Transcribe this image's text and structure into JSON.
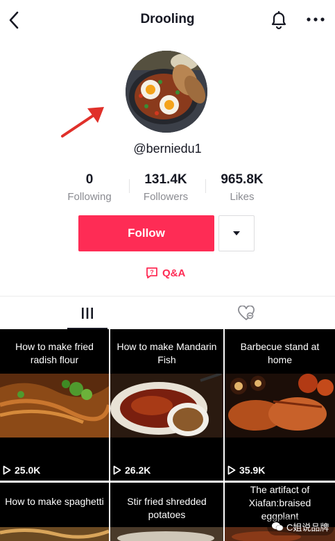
{
  "header": {
    "title": "Drooling",
    "back_icon": "chevron-left-icon",
    "bell_icon": "bell-icon",
    "more_icon": "more-dots-icon"
  },
  "profile": {
    "handle": "@berniedu1",
    "stats": [
      {
        "value": "0",
        "label": "Following"
      },
      {
        "value": "131.4K",
        "label": "Followers"
      },
      {
        "value": "965.8K",
        "label": "Likes"
      }
    ],
    "follow_label": "Follow",
    "qa_label": "Q&A"
  },
  "tabs": [
    "videos-grid-icon",
    "liked-heart-icon"
  ],
  "videos": [
    {
      "caption": "How to make fried radish flour",
      "plays": "25.0K"
    },
    {
      "caption": "How to make Mandarin Fish",
      "plays": "26.2K"
    },
    {
      "caption": "Barbecue stand at home",
      "plays": "35.9K"
    },
    {
      "caption": "How to make spaghetti",
      "plays": ""
    },
    {
      "caption": "Stir fried shredded potatoes",
      "plays": ""
    },
    {
      "caption": "The artifact of Xiafan:braised eggplant",
      "plays": ""
    }
  ],
  "colors": {
    "accent": "#fe2c55",
    "text": "#161823",
    "muted": "#8a8b91"
  }
}
